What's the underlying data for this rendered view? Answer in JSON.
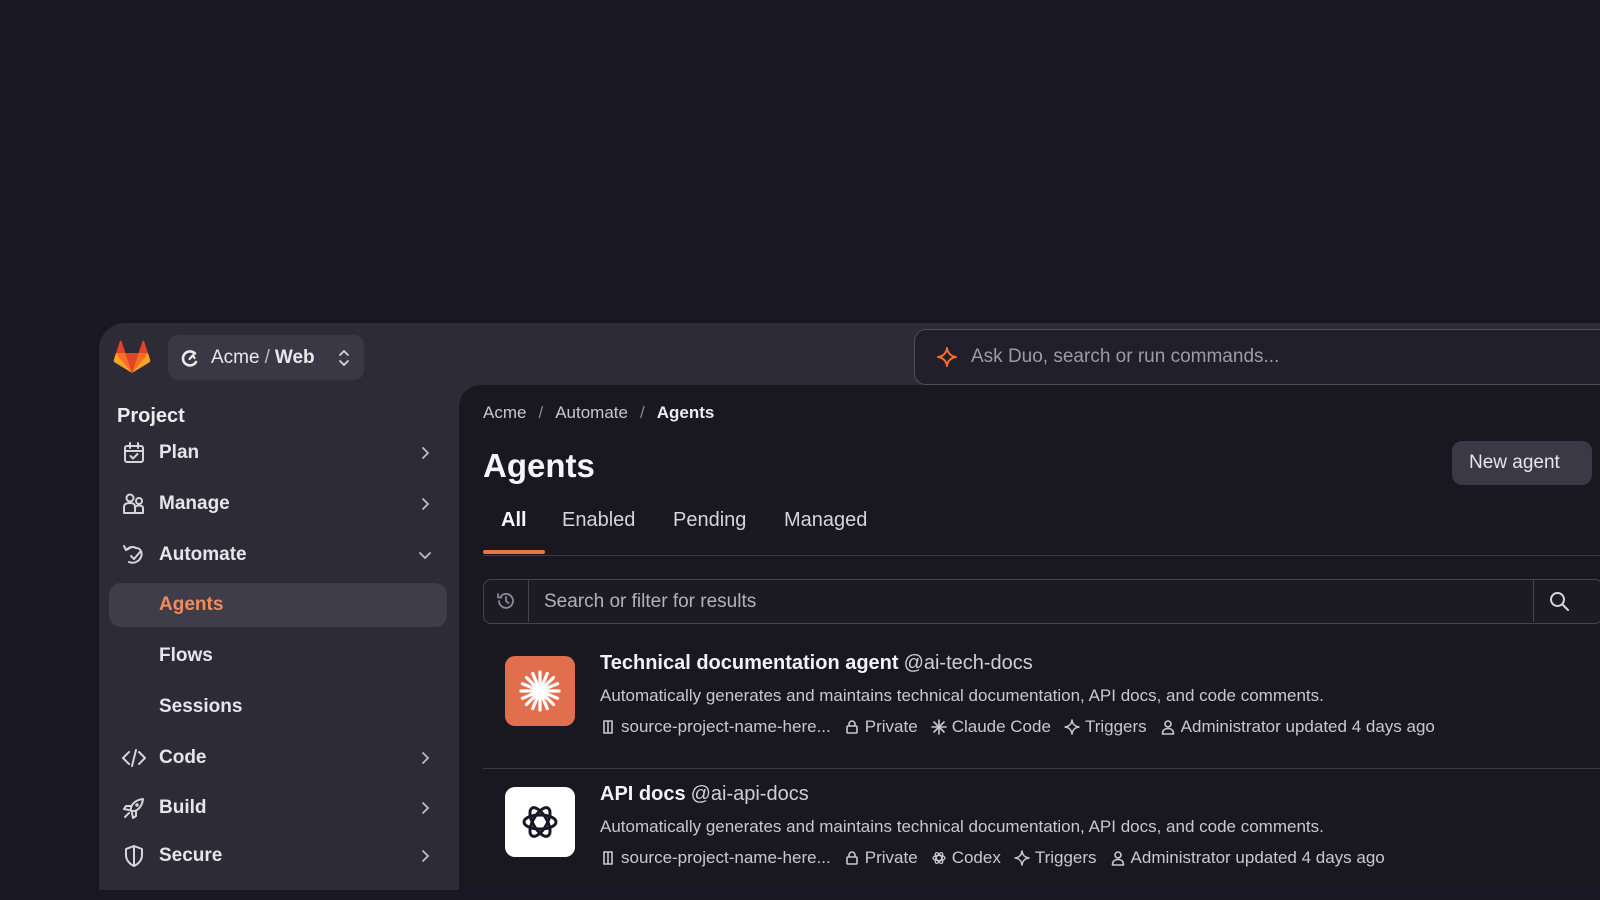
{
  "colors": {
    "background": "#1a1725",
    "panel": "#2d2b36",
    "main": "#19171f",
    "accent": "#e7773f",
    "active_label": "#f08c5c"
  },
  "topbar": {
    "logo_icon": "gitlab-tanuki-icon",
    "project": {
      "namespace": "Acme",
      "separator": "/",
      "name": "Web"
    },
    "search_placeholder": "Ask Duo, search or run commands..."
  },
  "sidebar": {
    "heading": "Project",
    "items": [
      {
        "label": "Plan",
        "icon": "calendar-icon"
      },
      {
        "label": "Manage",
        "icon": "users-icon"
      },
      {
        "label": "Automate",
        "icon": "automate-icon",
        "expanded": true
      },
      {
        "label": "Agents",
        "active": true
      },
      {
        "label": "Flows"
      },
      {
        "label": "Sessions"
      },
      {
        "label": "Code",
        "icon": "code-icon"
      },
      {
        "label": "Build",
        "icon": "rocket-icon"
      },
      {
        "label": "Secure",
        "icon": "shield-icon"
      }
    ]
  },
  "main": {
    "breadcrumb": [
      "Acme",
      "Automate",
      "Agents"
    ],
    "breadcrumb_separator": "/",
    "title": "Agents",
    "new_button": "New agent",
    "tabs": [
      "All",
      "Enabled",
      "Pending",
      "Managed"
    ],
    "active_tab": "All",
    "filter_placeholder": "Search or filter for results",
    "agents": [
      {
        "name": "Technical documentation agent",
        "handle": "@ai-tech-docs",
        "description": "Automatically generates and maintains technical documentation, API docs, and code comments.",
        "project": "source-project-name-here...",
        "visibility": "Private",
        "model": "Claude Code",
        "triggers": "Triggers",
        "updated": "Administrator updated 4 days ago",
        "avatar_icon": "claude-asterisk-icon"
      },
      {
        "name": "API docs",
        "handle": "@ai-api-docs",
        "description": "Automatically generates and maintains technical documentation, API docs, and code comments.",
        "project": "source-project-name-here...",
        "visibility": "Private",
        "model": "Codex",
        "triggers": "Triggers",
        "updated": "Administrator updated 4 days ago",
        "avatar_icon": "openai-knot-icon"
      }
    ]
  }
}
